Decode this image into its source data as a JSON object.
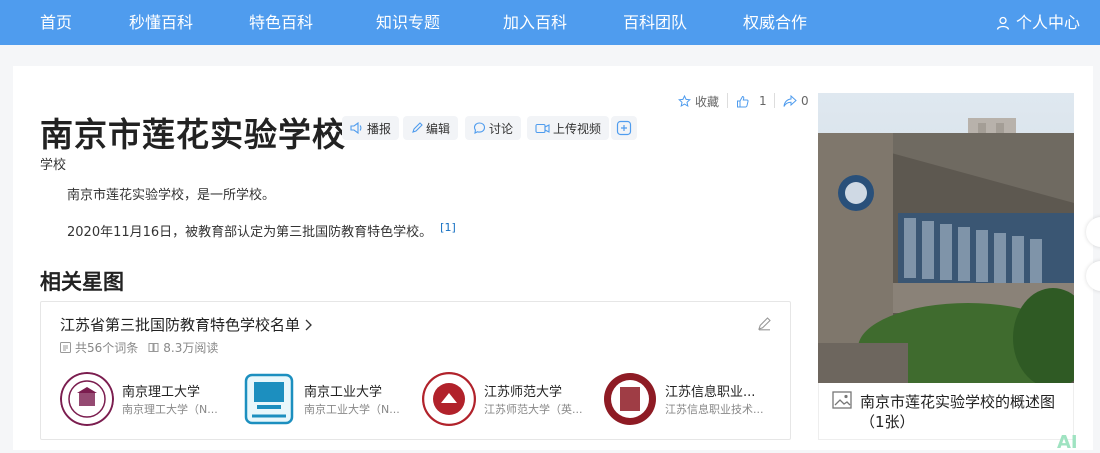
{
  "nav": {
    "items": [
      "首页",
      "秒懂百科",
      "特色百科",
      "知识专题",
      "加入百科",
      "百科团队",
      "权威合作"
    ],
    "user_label": "个人中心",
    "bg_color": "#4f9cee"
  },
  "entry": {
    "title": "南京市莲花实验学校",
    "subtitle": "学校",
    "tools": [
      "播报",
      "编辑",
      "讨论",
      "上传视频"
    ],
    "actions": {
      "favorite_label": "收藏",
      "like_count": "1",
      "share_count": "0"
    },
    "paragraphs": [
      {
        "text": "南京市莲花实验学校，是一所学校。",
        "ref": ""
      },
      {
        "text": "2020年11月16日，被教育部认定为第三批国防教育特色学校。",
        "ref": "[1]"
      }
    ]
  },
  "star_map": {
    "section_title": "相关星图",
    "list_title": "江苏省第三批国防教育特色学校名单",
    "entries_count": "共56个词条",
    "reads": "8.3万阅读",
    "schools": [
      {
        "name": "南京理工大学",
        "desc": "南京理工大学（N..."
      },
      {
        "name": "南京工业大学",
        "desc": "南京工业大学（N..."
      },
      {
        "name": "江苏师范大学",
        "desc": "江苏师范大学（英..."
      },
      {
        "name": "江苏信息职业...",
        "desc": "江苏信息职业技术..."
      }
    ]
  },
  "album": {
    "caption": "南京市莲花实验学校的概述图（1张）"
  },
  "ai_badge": "AI"
}
